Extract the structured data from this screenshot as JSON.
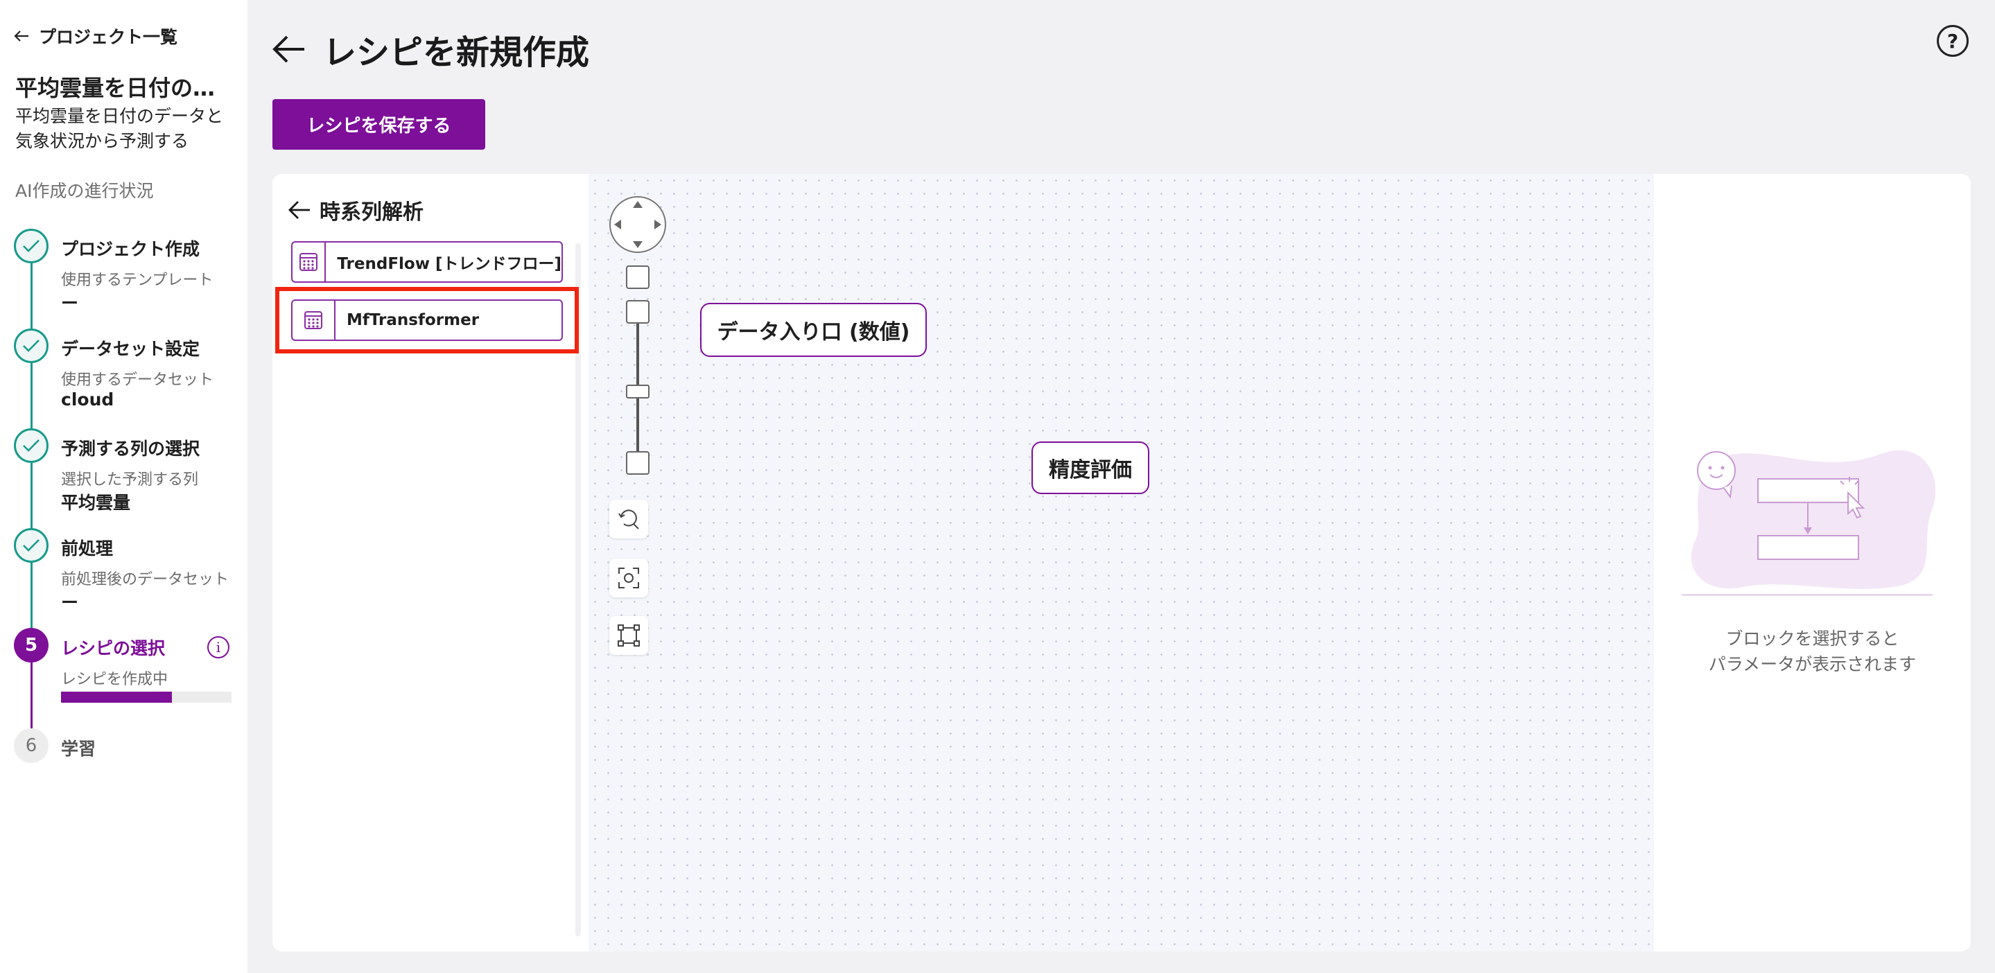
{
  "sidebar": {
    "back_label": "プロジェクト一覧",
    "project_title": "平均雲量を日付のデ...",
    "project_description": "平均雲量を日付のデータと気象状況から予測する",
    "progress_heading": "AI作成の進行状況",
    "steps": [
      {
        "title": "プロジェクト作成",
        "sub": "使用するテンプレート",
        "value": "ー",
        "status": "done"
      },
      {
        "title": "データセット設定",
        "sub": "使用するデータセット",
        "value": "cloud",
        "status": "done"
      },
      {
        "title": "予測する列の選択",
        "sub": "選択した予測する列",
        "value": "平均雲量",
        "status": "done"
      },
      {
        "title": "前処理",
        "sub": "前処理後のデータセット",
        "value": "ー",
        "status": "done"
      },
      {
        "number": "5",
        "title": "レシピの選択",
        "sub": "レシピを作成中",
        "status": "active",
        "progress": 0.65
      },
      {
        "number": "6",
        "title": "学習",
        "status": "pending"
      }
    ]
  },
  "header": {
    "title": "レシピを新規作成",
    "save_label": "レシピを保存する",
    "help_icon": "?"
  },
  "block_list": {
    "title": "時系列解析",
    "items": [
      {
        "label": "TrendFlow [トレンドフロー]"
      },
      {
        "label": "MfTransformer",
        "highlighted": true
      }
    ]
  },
  "canvas": {
    "nodes": [
      {
        "label": "データ入り口 (数値)"
      },
      {
        "label": "精度評価"
      }
    ]
  },
  "param_panel": {
    "empty_line1": "ブロックを選択すると",
    "empty_line2": "パラメータが表示されます"
  },
  "colors": {
    "accent": "#7d0f99",
    "step_done": "#1a9a8a",
    "highlight": "#f0250f"
  }
}
